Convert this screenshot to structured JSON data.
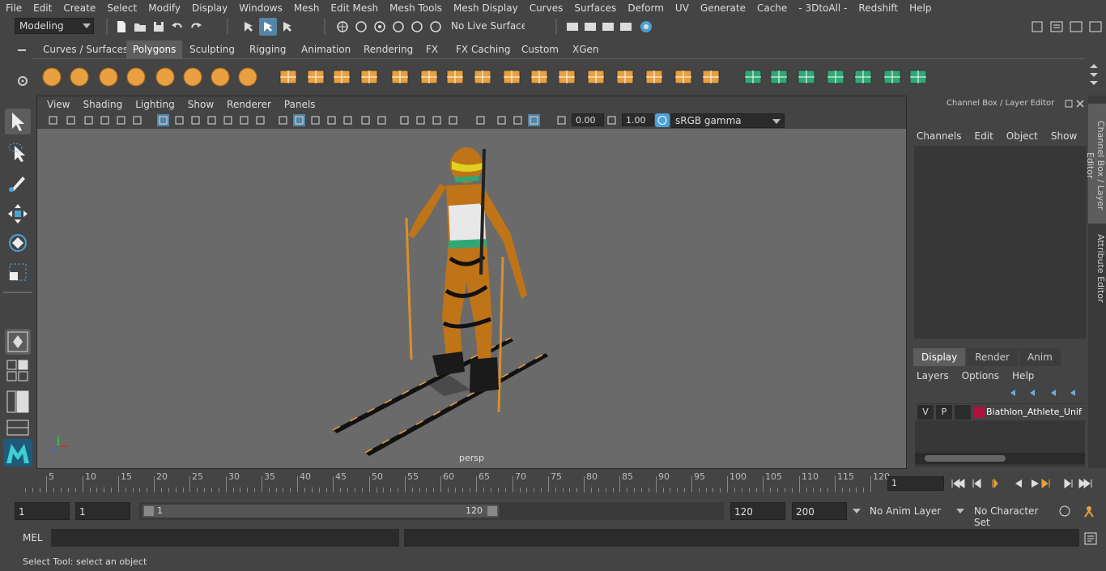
{
  "menubar": [
    "File",
    "Edit",
    "Create",
    "Select",
    "Modify",
    "Display",
    "Windows",
    "Mesh",
    "Edit Mesh",
    "Mesh Tools",
    "Mesh Display",
    "Curves",
    "Surfaces",
    "Deform",
    "UV",
    "Generate",
    "Cache",
    "- 3DtoAll -",
    "Redshift",
    "Help"
  ],
  "status": {
    "mode": "Modeling",
    "live_surface": "No Live Surface"
  },
  "shelf_tabs": [
    "Curves / Surfaces",
    "Polygons",
    "Sculpting",
    "Rigging",
    "Animation",
    "Rendering",
    "FX",
    "FX Caching",
    "Custom",
    "XGen"
  ],
  "active_shelf_tab": "Polygons",
  "panel_menu": [
    "View",
    "Shading",
    "Lighting",
    "Show",
    "Renderer",
    "Panels"
  ],
  "panel_bar": {
    "exposure": "0.00",
    "gamma": "1.00",
    "color_space": "sRGB gamma"
  },
  "viewport": {
    "camera_label": "persp"
  },
  "channel_box": {
    "title": "Channel Box / Layer Editor",
    "menu": [
      "Channels",
      "Edit",
      "Object",
      "Show"
    ]
  },
  "layer_editor": {
    "tabs": [
      "Display",
      "Render",
      "Anim"
    ],
    "active_tab": "Display",
    "menu": [
      "Layers",
      "Options",
      "Help"
    ],
    "layers": [
      {
        "v": "V",
        "p": "P",
        "name": "Biathlon_Athlete_Unif",
        "color": "#b0103a"
      }
    ]
  },
  "side_tabs": [
    "Channel Box / Layer Editor",
    "Attribute Editor"
  ],
  "timeline": {
    "ticks": [
      5,
      10,
      15,
      20,
      25,
      30,
      35,
      40,
      45,
      50,
      55,
      60,
      65,
      70,
      75,
      80,
      85,
      90,
      95,
      100,
      105,
      110,
      115,
      120
    ],
    "start_label": "1",
    "current_frame": "1"
  },
  "range": {
    "start": "1",
    "anim_start": "1",
    "range_start": "1",
    "range_end": "120",
    "end": "120",
    "anim_end": "200",
    "anim_layer": "No Anim Layer",
    "character_set": "No Character Set"
  },
  "cmdline": {
    "label": "MEL"
  },
  "help_line": "Select Tool: select an object",
  "colors": {
    "bg": "#444444",
    "viewport": "#6a6a6a",
    "accent": "#5285a6",
    "orange": "#e8a040"
  }
}
